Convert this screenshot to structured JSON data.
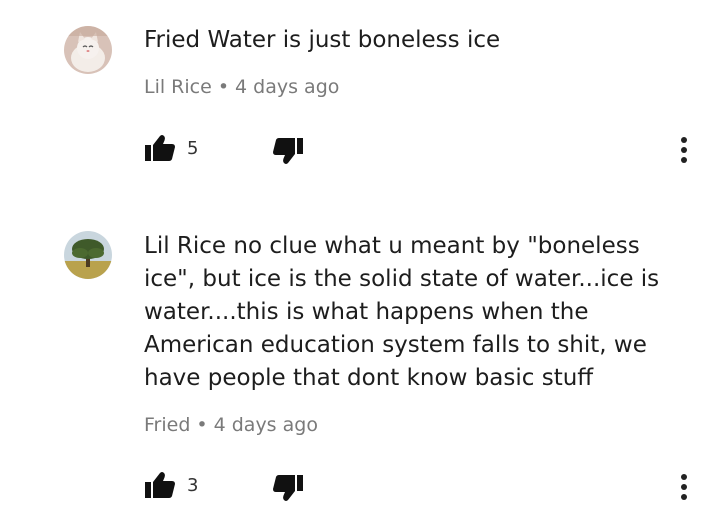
{
  "comments": [
    {
      "text": "Fried Water is just boneless ice",
      "author": "Lil Rice",
      "separator": "•",
      "time": "4 days ago",
      "likes": "5",
      "avatar_icon": "cat-avatar-icon"
    },
    {
      "text": "Lil Rice no clue what u meant by \"boneless ice\", but ice is the solid state of water...ice is water....this is what happens when the American education system falls to shit, we have people that dont know basic stuff",
      "author": "Fried",
      "separator": "•",
      "time": "4 days ago",
      "likes": "3",
      "avatar_icon": "tree-avatar-icon"
    }
  ],
  "colors": {
    "text": "#1d1d1d",
    "meta": "#7a7a7a",
    "icon": "#111111"
  }
}
